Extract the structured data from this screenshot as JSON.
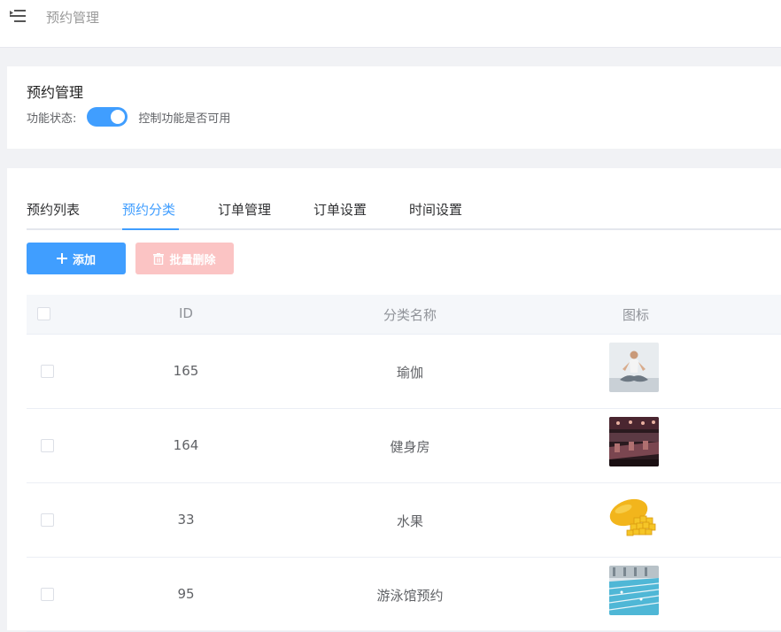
{
  "topbar": {
    "title": "预约管理",
    "menu_icon": "menu-fold-icon"
  },
  "feature": {
    "title": "预约管理",
    "status_label": "功能状态:",
    "switch_on": true,
    "status_desc": "控制功能是否可用"
  },
  "tabs": [
    {
      "label": "预约列表",
      "active": false
    },
    {
      "label": "预约分类",
      "active": true
    },
    {
      "label": "订单管理",
      "active": false
    },
    {
      "label": "订单设置",
      "active": false
    },
    {
      "label": "时间设置",
      "active": false
    }
  ],
  "toolbar": {
    "add_label": "添加",
    "batch_delete_label": "批量删除"
  },
  "table": {
    "headers": {
      "id": "ID",
      "name": "分类名称",
      "icon": "图标"
    },
    "rows": [
      {
        "id": "165",
        "name": "瑜伽",
        "icon": "yoga-image"
      },
      {
        "id": "164",
        "name": "健身房",
        "icon": "gym-image"
      },
      {
        "id": "33",
        "name": "水果",
        "icon": "mango-image"
      },
      {
        "id": "95",
        "name": "游泳馆预约",
        "icon": "swimming-pool-image"
      }
    ]
  },
  "colors": {
    "primary": "#409eff",
    "danger_disabled": "#fbc4c4"
  }
}
